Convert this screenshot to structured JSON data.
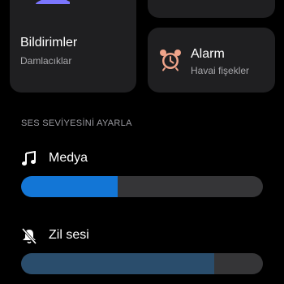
{
  "tiles": {
    "notifications": {
      "title": "Bildirimler",
      "subtitle": "Damlacıklar",
      "icon": "bell-icon",
      "icon_color": "#7b76ff"
    },
    "alarm": {
      "title": "Alarm",
      "subtitle": "Havai fişekler",
      "icon": "alarm-clock-icon",
      "icon_color": "#f0a48a"
    }
  },
  "volume": {
    "header": "SES SEVİYESİNİ AYARLA",
    "items": [
      {
        "label": "Medya",
        "icon": "music-note-icon",
        "level": 0.4,
        "color": "#1376d6"
      },
      {
        "label": "Zil sesi",
        "icon": "bell-off-icon",
        "level": 0.8,
        "color": "#2a4d6c"
      }
    ]
  }
}
